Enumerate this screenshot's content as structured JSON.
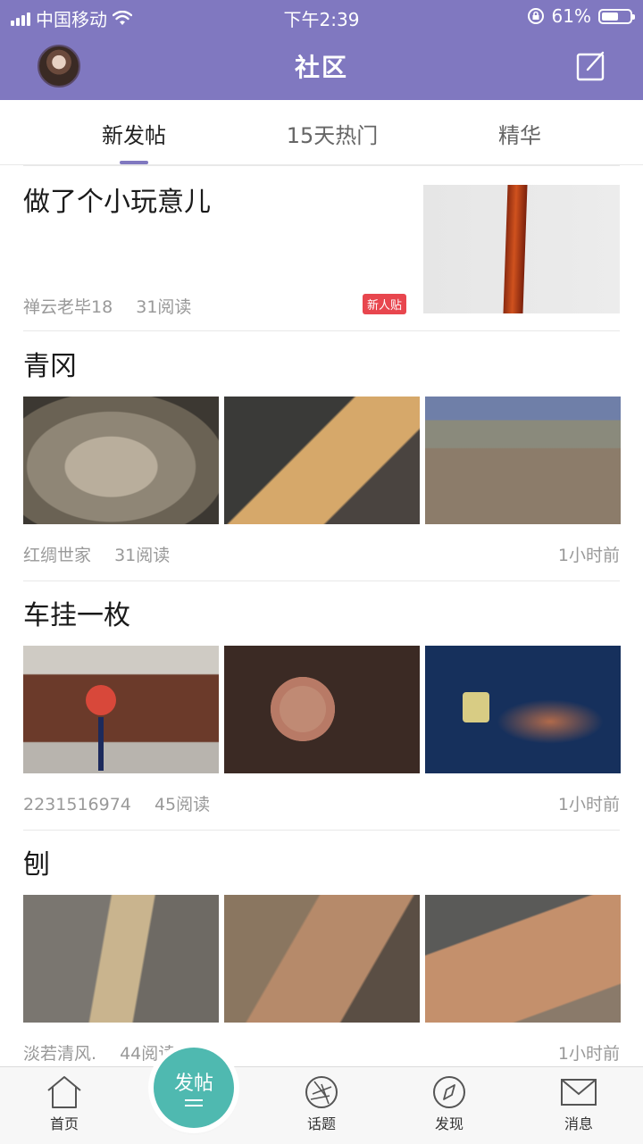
{
  "status_bar": {
    "carrier": "中国移动",
    "time": "下午2:39",
    "battery_text": "61%",
    "battery_level": 0.61
  },
  "nav": {
    "title": "社区"
  },
  "tabs": [
    {
      "label": "新发帖",
      "active": true
    },
    {
      "label": "15天热门",
      "active": false
    },
    {
      "label": "精华",
      "active": false
    }
  ],
  "posts": [
    {
      "title": "做了个小玩意儿",
      "author": "禅云老毕18",
      "reads": "31阅读",
      "badge": "新人贴",
      "time": ""
    },
    {
      "title": "青冈",
      "author": "红绸世家",
      "reads": "31阅读",
      "badge": "",
      "time": "1小时前"
    },
    {
      "title": "车挂一枚",
      "author": "2231516974",
      "reads": "45阅读",
      "badge": "",
      "time": "1小时前"
    },
    {
      "title": "刨",
      "author": "淡若清风.",
      "reads": "44阅读",
      "badge": "",
      "time": "1小时前"
    }
  ],
  "fab": {
    "label": "发帖"
  },
  "bottom_tabs": [
    {
      "label": "首页",
      "icon": "home-icon"
    },
    {
      "label": "话题",
      "icon": "aperture-icon"
    },
    {
      "label": "发现",
      "icon": "compass-icon"
    },
    {
      "label": "消息",
      "icon": "mail-icon"
    }
  ],
  "colors": {
    "accent": "#8078c0",
    "fab": "#4fb9b0",
    "badge": "#e8464e"
  }
}
